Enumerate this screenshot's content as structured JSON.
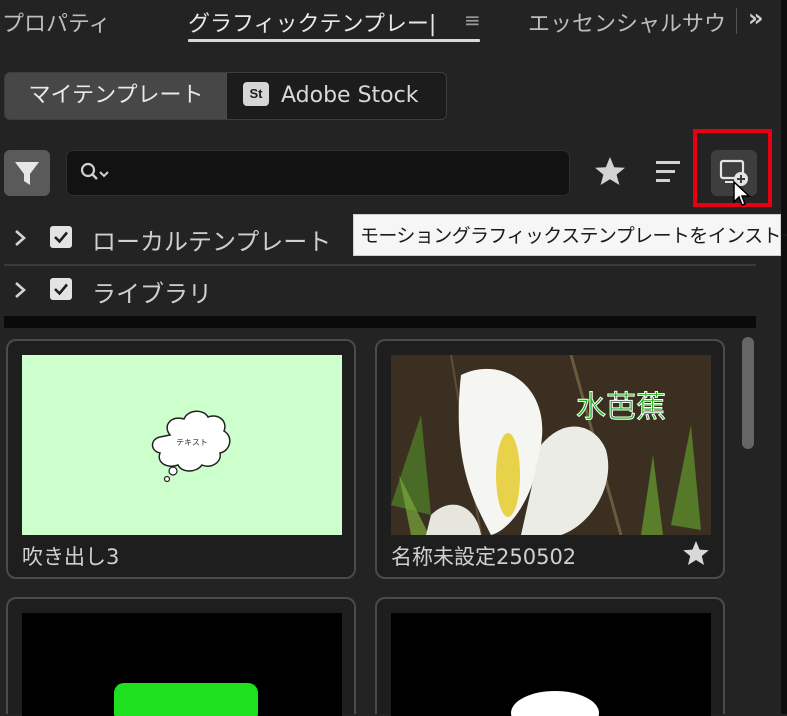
{
  "tabs": [
    {
      "label": "プロパティ",
      "active": false
    },
    {
      "label": "グラフィックテンプレー|",
      "active": true
    },
    {
      "label": "エッセンシャルサウ",
      "active": false
    }
  ],
  "tab_more_label": "»",
  "toggle": {
    "my_templates": "マイテンプレート",
    "stock_badge": "St",
    "adobe_stock": "Adobe Stock"
  },
  "search": {
    "value": "",
    "placeholder": ""
  },
  "tooltip": "モーショングラフィックステンプレートをインストール",
  "tree": [
    {
      "label": "ローカルテンプレート",
      "checked": true
    },
    {
      "label": "ライブラリ",
      "checked": true
    }
  ],
  "cards": [
    {
      "name": "吹き出し3",
      "thumb_bg": "#ccffcc",
      "bubble_text": "テキスト",
      "favorite": false
    },
    {
      "name": "名称未設定250502",
      "thumb_overlay_text": "水芭蕉",
      "overlay_color": "#1db31d",
      "favorite": true
    },
    {
      "name": "",
      "shape": "green-rounded-rect",
      "shape_color": "#1fe01f"
    },
    {
      "name": "",
      "shape": "white-ellipse",
      "shape_color": "#ffffff"
    }
  ],
  "colors": {
    "accent_highlight": "#e60012",
    "panel_bg": "#232323"
  }
}
